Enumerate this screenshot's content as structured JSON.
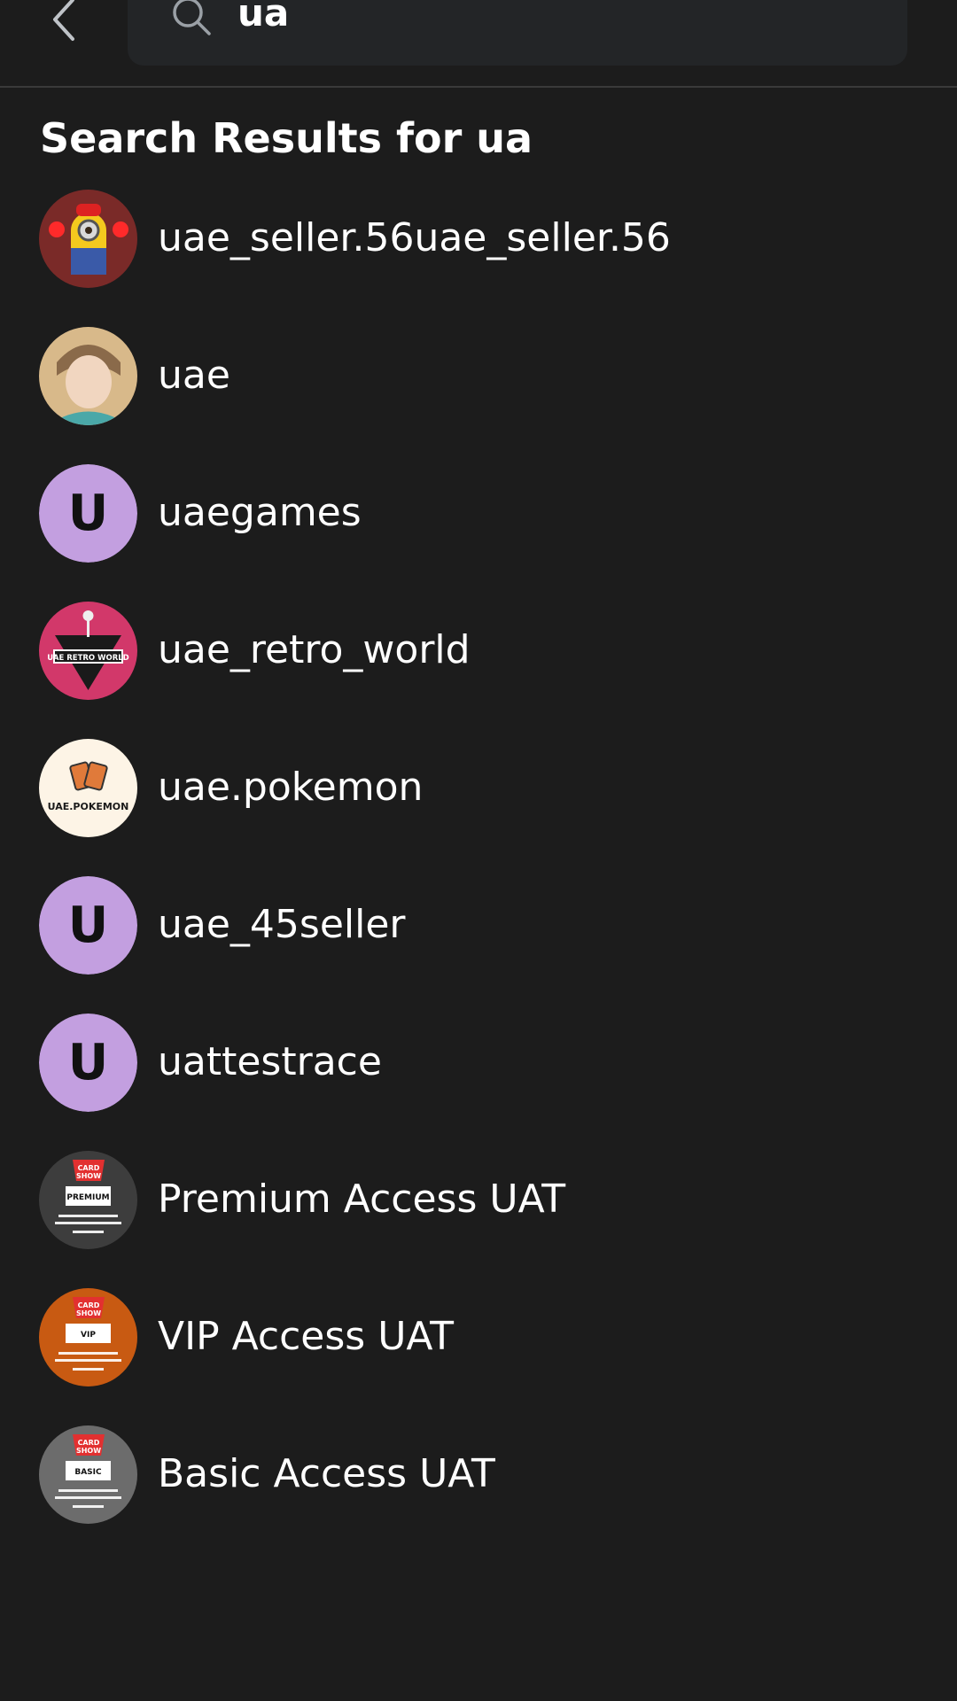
{
  "search": {
    "query": "ua",
    "back_icon": "chevron-left-icon",
    "search_icon": "search-icon"
  },
  "results_title": "Search Results for ua",
  "results": [
    {
      "name": "uae_seller.56uae_seller.56",
      "avatar_type": "image",
      "avatar_desc": "minion-character",
      "bg": "#7a2a28"
    },
    {
      "name": "uae",
      "avatar_type": "image",
      "avatar_desc": "anime-character",
      "bg": "#d8b98a"
    },
    {
      "name": "uaegames",
      "avatar_type": "initial",
      "initial": "U",
      "bg": "#c39fe0"
    },
    {
      "name": "uae_retro_world",
      "avatar_type": "image",
      "avatar_desc": "retro-joystick-logo",
      "logo_text": "UAE RETRO WORLD",
      "bg": "#d2386a"
    },
    {
      "name": "uae.pokemon",
      "avatar_type": "image",
      "avatar_desc": "pokemon-cards-logo",
      "logo_text": "UAE.POKEMON",
      "bg": "#fdf4e6"
    },
    {
      "name": "uae_45seller",
      "avatar_type": "initial",
      "initial": "U",
      "bg": "#c39fe0"
    },
    {
      "name": "uattestrace",
      "avatar_type": "initial",
      "initial": "U",
      "bg": "#c39fe0"
    },
    {
      "name": "Premium Access UAT",
      "avatar_type": "image",
      "avatar_desc": "card-show-ticket",
      "badge_text": "PREMIUM",
      "bg": "#3d3d3d"
    },
    {
      "name": "VIP Access UAT",
      "avatar_type": "image",
      "avatar_desc": "card-show-ticket",
      "badge_text": "VIP",
      "bg": "#c85a12"
    },
    {
      "name": "Basic Access UAT",
      "avatar_type": "image",
      "avatar_desc": "card-show-ticket",
      "badge_text": "BASIC",
      "bg": "#6c6c6c"
    }
  ]
}
